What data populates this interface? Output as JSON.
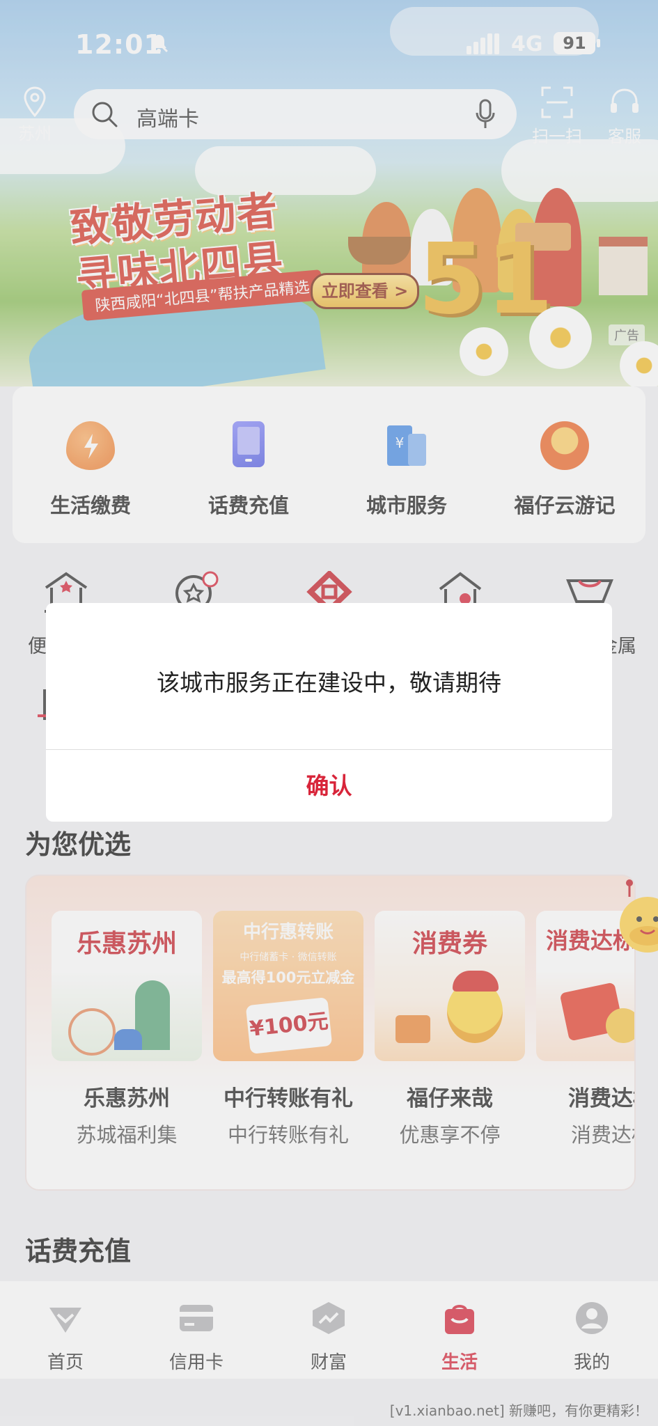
{
  "status_bar": {
    "time": "12:01",
    "network": "4G",
    "battery": "91"
  },
  "header": {
    "location": "苏州",
    "search_placeholder": "高端卡",
    "scan_label": "扫一扫",
    "service_label": "客服"
  },
  "banner": {
    "line1": "致敬劳动者",
    "line2": "寻味北四县",
    "subtitle": "陕西咸阳“北四县”帮扶产品精选",
    "cta": "立即查看 >",
    "big_number": "51",
    "ad_tag": "广告"
  },
  "quick_services": [
    {
      "label": "生活缴费",
      "icon": "flame-bolt-icon"
    },
    {
      "label": "话费充值",
      "icon": "phone-icon"
    },
    {
      "label": "城市服务",
      "icon": "city-building-icon"
    },
    {
      "label": "福仔云游记",
      "icon": "mascot-icon"
    }
  ],
  "grid_partial": {
    "left_label": "便",
    "right_label": "金属"
  },
  "section_recommend": "为您优选",
  "recommend_cards": [
    {
      "image_title": "乐惠苏州",
      "title": "乐惠苏州",
      "subtitle": "苏城福利集"
    },
    {
      "image_title": "中行惠转账",
      "image_line1": "中行储蓄卡 · 微信转账",
      "image_line2": "最高得100元立减金",
      "image_amount": "¥100元",
      "title": "中行转账有礼",
      "subtitle": "中行转账有礼"
    },
    {
      "image_title": "消费券",
      "title": "福仔来哉",
      "subtitle": "优惠享不停"
    },
    {
      "image_title": "消费达标",
      "title": "消费达标",
      "subtitle": "消费达标"
    }
  ],
  "section_topup": "话费充值",
  "bottom_nav": [
    {
      "label": "首页",
      "icon": "home-icon"
    },
    {
      "label": "信用卡",
      "icon": "credit-card-icon"
    },
    {
      "label": "财富",
      "icon": "wealth-icon"
    },
    {
      "label": "生活",
      "icon": "life-bag-icon",
      "active": true
    },
    {
      "label": "我的",
      "icon": "user-icon"
    }
  ],
  "dialog": {
    "message": "该城市服务正在建设中，敬请期待",
    "confirm": "确认"
  },
  "watermark": "[v1.xianbao.net] 新赚吧，有你更精彩！",
  "colors": {
    "accent": "#d8253a",
    "banner_title": "#d83a2a",
    "cta_gold": "#f0b93c"
  }
}
